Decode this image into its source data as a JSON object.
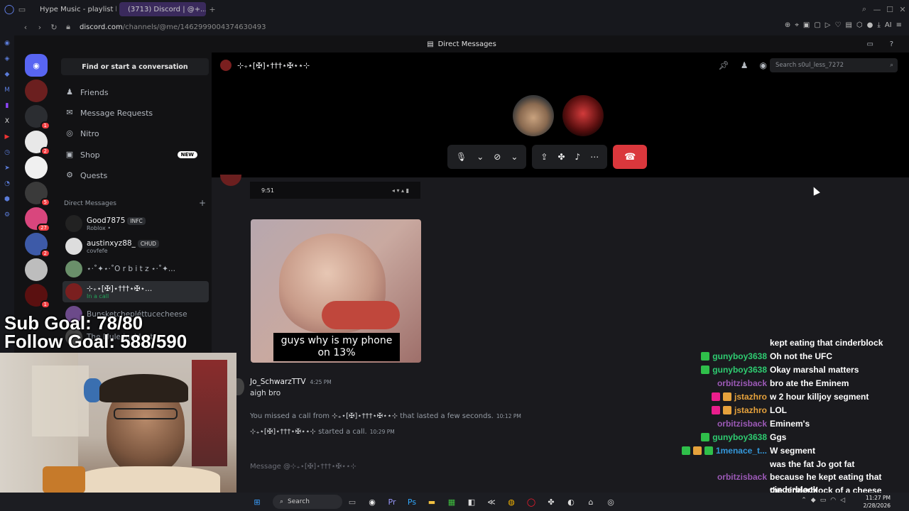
{
  "browser": {
    "tabs": [
      {
        "label": "Hype Music - playlist by J...",
        "active": false
      },
      {
        "label": "(3713) Discord | @+...",
        "active": true
      }
    ],
    "url_host": "discord.com",
    "url_path": "/channels/@me/1462999004374630493"
  },
  "discord": {
    "topbar_title": "Direct Messages",
    "find_conversation": "Find or start a conversation",
    "nav": [
      {
        "label": "Friends",
        "icon": "friends-icon"
      },
      {
        "label": "Message Requests",
        "icon": "mail-icon"
      },
      {
        "label": "Nitro",
        "icon": "nitro-icon"
      },
      {
        "label": "Shop",
        "icon": "shop-icon",
        "badge": "NEW"
      },
      {
        "label": "Quests",
        "icon": "quests-icon"
      }
    ],
    "dm_header": "Direct Messages",
    "dm_add": "+",
    "dms": [
      {
        "name": "Good7875",
        "tag": "INFC",
        "sub": "Roblox •"
      },
      {
        "name": "austinxyz88_",
        "tag": "CHUD",
        "sub": "covfefe"
      },
      {
        "name": "⋆·˚✦⋆·˚O r b i t z ⋆·˚✦...",
        "tag": "",
        "sub": ""
      },
      {
        "name": "⊹₊⋆[✠]⋆†††⋆✠⋆...",
        "tag": "",
        "sub": "In a call"
      },
      {
        "name": "Bunsketchepléttucecheese",
        "tag": "",
        "sub": ""
      },
      {
        "name": "The Mule Incident",
        "tag": "",
        "sub": ""
      }
    ],
    "server_badges": [
      "1",
      "2",
      "5",
      "27",
      "2",
      "1"
    ],
    "channel_title": "⊹₊⋆[✠]⋆†††⋆✠⋆⋆⊹",
    "search_placeholder": "Search s0ul_less_7272",
    "phone_time": "9:51",
    "meme_caption": "guys why is my phone on 13%",
    "message": {
      "author": "Jo_SchwarzTTV",
      "time": "4:25 PM",
      "text": "aigh bro"
    },
    "system_messages": [
      {
        "prefix": "You missed a call from",
        "name": "⊹₊⋆[✠]⋆†††⋆✠⋆⋆⊹",
        "suffix": "that lasted a few seconds.",
        "time": "10:12 PM"
      },
      {
        "prefix": "",
        "name": "⊹₊⋆[✠]⋆†††⋆✠⋆⋆⊹",
        "suffix": "started a call.",
        "time": "10:29 PM"
      }
    ],
    "input_placeholder": "Message @⊹₊⋆[✠]⋆†††⋆✠⋆⋆⊹"
  },
  "stream": {
    "sub_goal": "Sub Goal: 78/80",
    "follow_goal": "Follow Goal: 588/590",
    "chat": [
      {
        "user": "",
        "color": "#ffffff",
        "text": "kept eating that cinderblock",
        "badges": []
      },
      {
        "user": "gunyboy3638",
        "color": "#2ecc71",
        "text": "Oh not the UFC",
        "badges": [
          "#2fbf4a"
        ]
      },
      {
        "user": "gunyboy3638",
        "color": "#2ecc71",
        "text": "Okay marshal matters",
        "badges": [
          "#2fbf4a"
        ]
      },
      {
        "user": "orbitzisback",
        "color": "#9b59b6",
        "text": "bro ate the Eminem",
        "badges": []
      },
      {
        "user": "jstazhro",
        "color": "#e6a23c",
        "text": "w 2 hour killjoy segment",
        "badges": [
          "#e91e8c",
          "#e6a23c"
        ]
      },
      {
        "user": "jstazhro",
        "color": "#e6a23c",
        "text": "LOL",
        "badges": [
          "#e91e8c",
          "#e6a23c"
        ]
      },
      {
        "user": "orbitzisback",
        "color": "#9b59b6",
        "text": "Eminem's",
        "badges": []
      },
      {
        "user": "gunyboy3638",
        "color": "#2ecc71",
        "text": "Ggs",
        "badges": [
          "#2fbf4a"
        ]
      },
      {
        "user": "1menace_t...",
        "color": "#3498db",
        "text": "W segment",
        "badges": [
          "#2fbf4a",
          "#e6a23c",
          "#2fbf4a"
        ]
      },
      {
        "user": "orbitzisback",
        "color": "#9b59b6",
        "text": "was the fat Jo got fat because he kept eating that cinderblock",
        "badges": []
      },
      {
        "user": "orbitzisback",
        "color": "#9b59b6",
        "text": "the cinderblock of a cheese sandwich",
        "badges": []
      }
    ]
  },
  "taskbar": {
    "search_label": "Search",
    "time": "11:27 PM",
    "date": "2/28/2026"
  }
}
